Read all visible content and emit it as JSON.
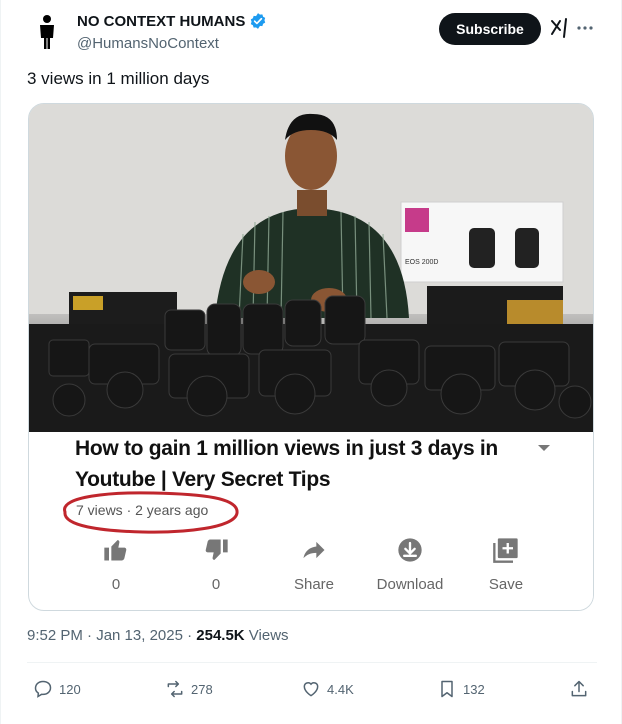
{
  "author": {
    "name": "NO CONTEXT HUMANS",
    "handle": "@HumansNoContext",
    "verified": true
  },
  "header": {
    "subscribe_label": "Subscribe"
  },
  "tweet": {
    "text": "3 views in 1 million days"
  },
  "media": {
    "box_text": "EOS 200D",
    "youtube": {
      "title_line1": "How to gain 1 million views in just 3 days in",
      "title_line2": "Youtube | Very Secret Tips",
      "meta": "7 views · 2 years ago",
      "likes": "0",
      "dislikes": "0",
      "share_label": "Share",
      "download_label": "Download",
      "save_label": "Save"
    }
  },
  "footer": {
    "time": "9:52 PM · Jan 13, 2025 · ",
    "views_count": "254.5K",
    "views_label": " Views"
  },
  "actions": {
    "replies": "120",
    "reposts": "278",
    "likes": "4.4K",
    "bookmarks": "132"
  },
  "colors": {
    "accent": "#1d9bf0",
    "highlight": "#c0262d"
  }
}
